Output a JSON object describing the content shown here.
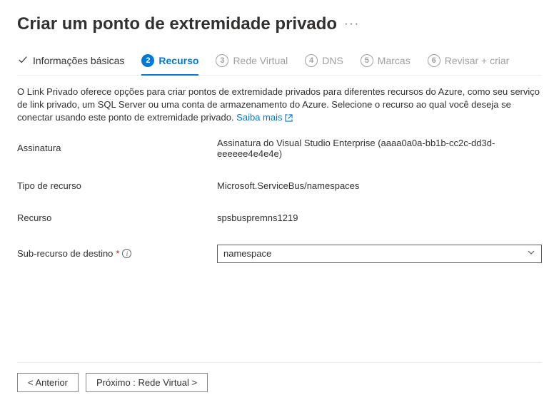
{
  "header": {
    "title": "Criar um ponto de extremidade privado",
    "more_label": "···"
  },
  "tabs": {
    "basics": "Informações básicas",
    "resource": "Recurso",
    "vnet": {
      "num": "3",
      "label": "Rede Virtual"
    },
    "dns": {
      "num": "4",
      "label": "DNS"
    },
    "tags": {
      "num": "5",
      "label": "Marcas"
    },
    "review": {
      "num": "6",
      "label": "Revisar + criar"
    }
  },
  "description": "O Link Privado oferece opções para criar pontos de extremidade privados para diferentes recursos do Azure, como seu serviço de link privado, um SQL Server ou uma conta de armazenamento do Azure. Selecione o recurso ao qual você deseja se conectar usando este ponto de extremidade privado.",
  "learn_more": "Saiba mais",
  "fields": {
    "subscription": {
      "label": "Assinatura",
      "value": "Assinatura do Visual Studio Enterprise (aaaa0a0a-bb1b-cc2c-dd3d-eeeeee4e4e4e)"
    },
    "resource_type": {
      "label": "Tipo de recurso",
      "value": "Microsoft.ServiceBus/namespaces"
    },
    "resource": {
      "label": "Recurso",
      "value": "spsbuspremns1219"
    },
    "sub_resource": {
      "label": "Sub-recurso de destino",
      "value": "namespace"
    }
  },
  "footer": {
    "prev": "< Anterior",
    "next": "Próximo : Rede Virtual >"
  }
}
